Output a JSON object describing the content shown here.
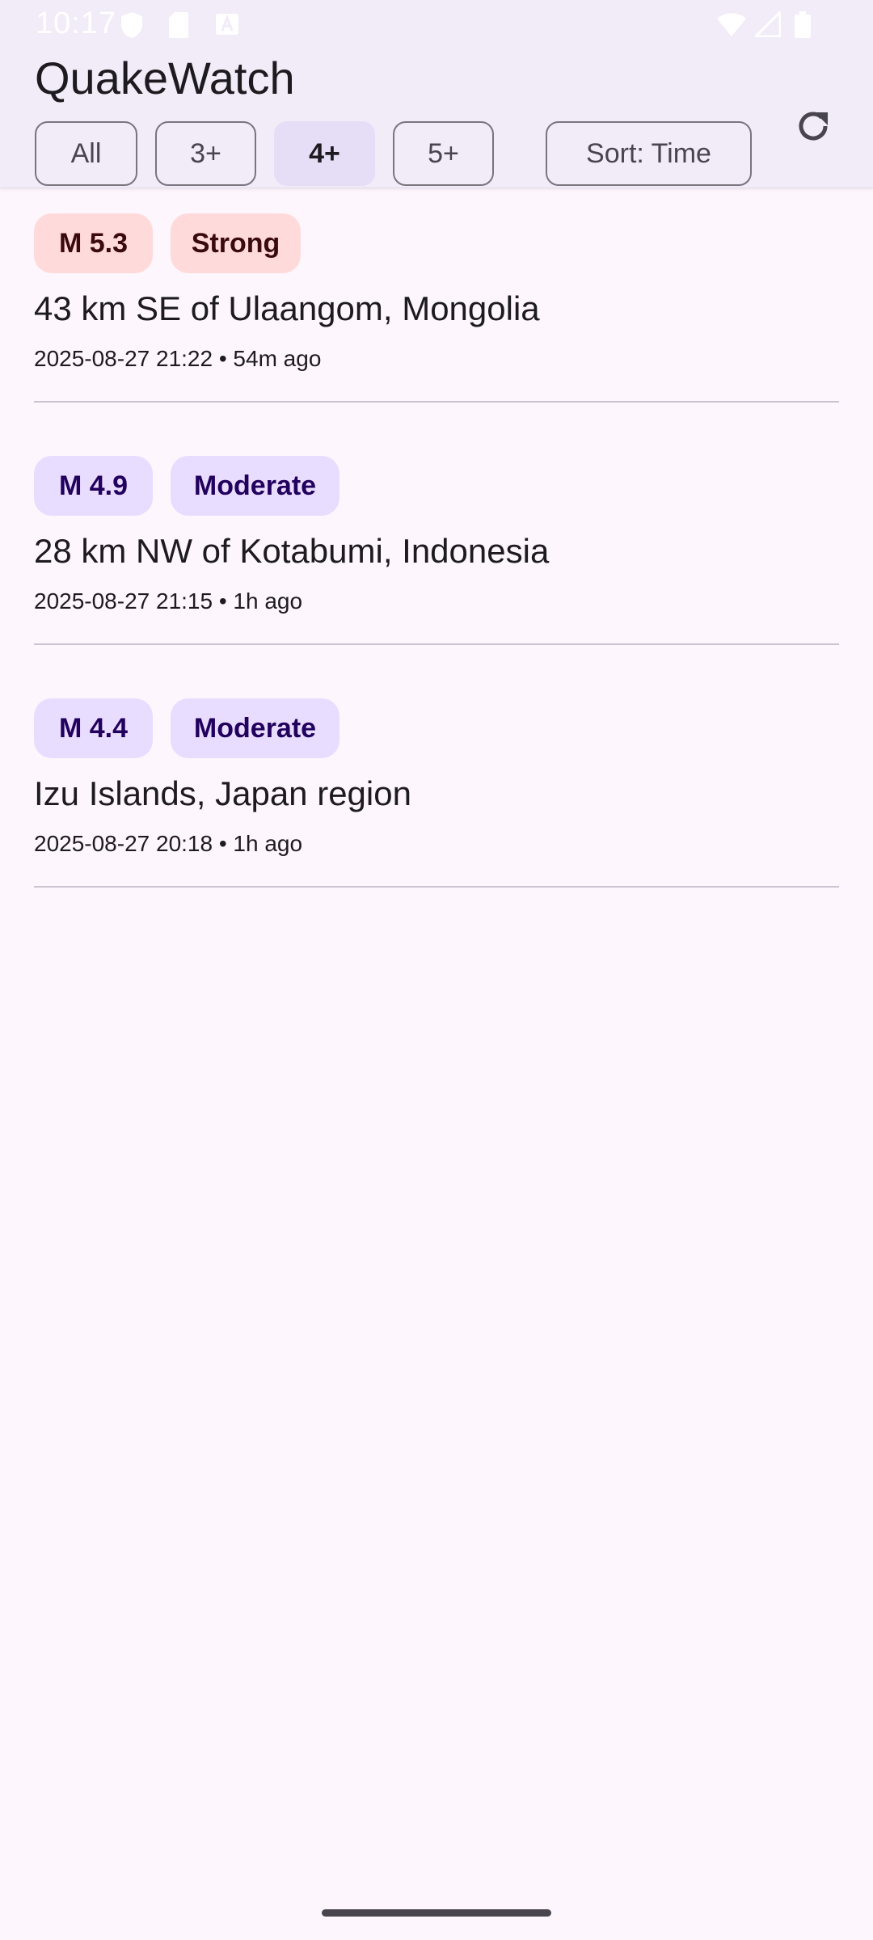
{
  "status_bar": {
    "time": "10:17",
    "icons": [
      "shield-icon",
      "sd-card-icon",
      "android-icon",
      "wifi-icon",
      "signal-icon",
      "battery-icon"
    ]
  },
  "app": {
    "title": "QuakeWatch",
    "refresh_icon": "refresh-icon"
  },
  "filters": {
    "chips": [
      {
        "label": "All",
        "selected": false
      },
      {
        "label": "3+",
        "selected": false
      },
      {
        "label": "4+",
        "selected": true
      },
      {
        "label": "5+",
        "selected": false
      }
    ],
    "sort_label": "Sort: Time"
  },
  "colors": {
    "strong_badge_bg": "#FFDADB",
    "moderate_badge_bg": "#E9DDFF",
    "selected_chip_bg": "#E6DEF6",
    "topbar_bg": "#F2EBF8"
  },
  "quakes": [
    {
      "magnitude": "M 5.3",
      "intensity": "Strong",
      "place": "43 km SE of Ulaangom, Mongolia",
      "meta": "2025-08-27 21:22 • 54m ago"
    },
    {
      "magnitude": "M 4.9",
      "intensity": "Moderate",
      "place": "28 km NW of Kotabumi, Indonesia",
      "meta": "2025-08-27 21:15 • 1h ago"
    },
    {
      "magnitude": "M 4.4",
      "intensity": "Moderate",
      "place": "Izu Islands, Japan region",
      "meta": "2025-08-27 20:18 • 1h ago"
    }
  ]
}
